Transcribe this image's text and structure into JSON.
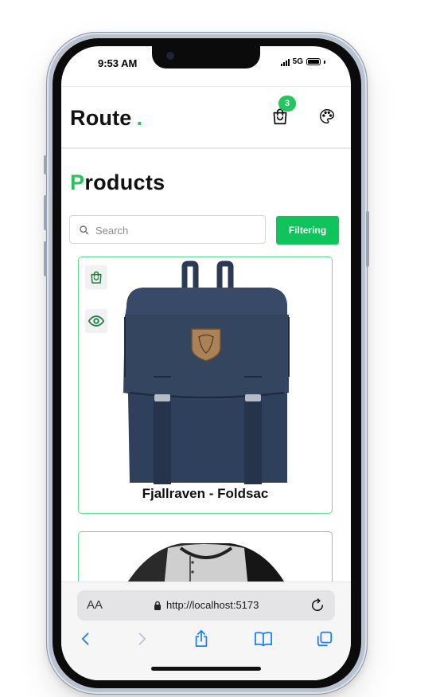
{
  "status_bar": {
    "time": "9:53 AM",
    "network": "5G"
  },
  "header": {
    "brand": "Route",
    "brand_dot": ".",
    "cart_count": "3",
    "cart_icon": "shopping-bag-icon",
    "theme_icon": "palette-icon"
  },
  "page": {
    "title_first_letter": "P",
    "title_rest": "roducts"
  },
  "search": {
    "placeholder": "Search",
    "value": ""
  },
  "filter_button": {
    "label": "Filtering"
  },
  "products": [
    {
      "title": "Fjallraven - Foldsac",
      "actions": [
        "add-to-cart",
        "quick-view"
      ]
    },
    {
      "title": ""
    }
  ],
  "browser": {
    "text_size_label": "AA",
    "url": "http://localhost:5173"
  },
  "colors": {
    "accent": "#22c55e",
    "filter_button": "#10c45c",
    "card_border": "#5fdc8f",
    "ios_blue": "#1a7ef5"
  }
}
